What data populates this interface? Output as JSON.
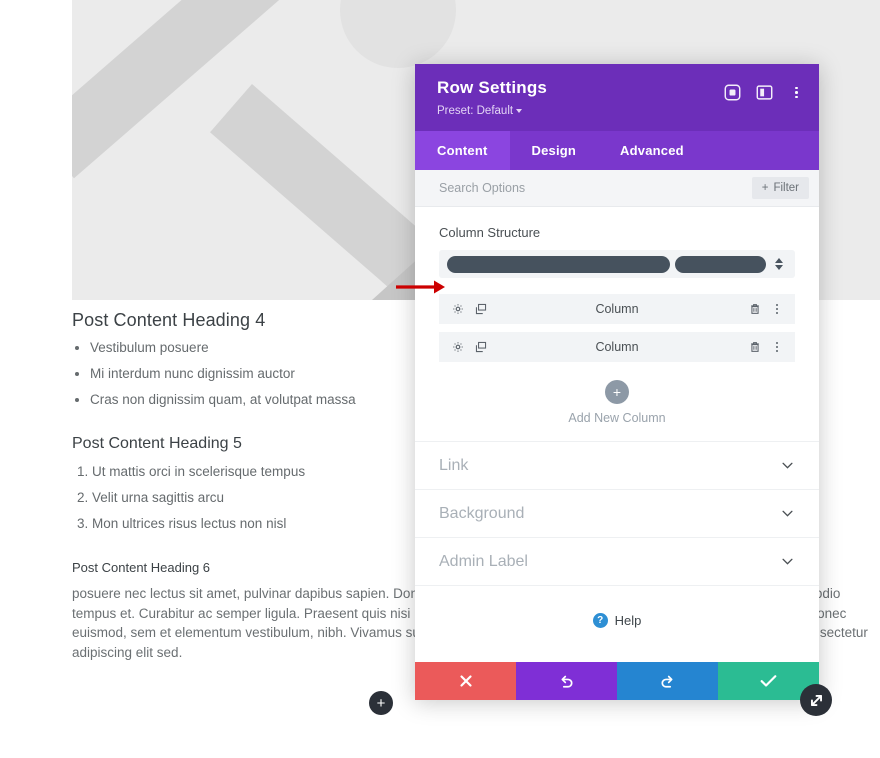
{
  "page": {
    "hero": {
      "alt": "placeholder-image"
    },
    "sections": [
      {
        "heading": "Post Content Heading 4",
        "list_type": "bullet",
        "items": [
          "Vestibulum posuere",
          "Mi interdum nunc dignissim auctor",
          "Cras non dignissim quam, at volutpat massa"
        ]
      },
      {
        "heading": "Post Content Heading 5",
        "list_type": "number",
        "items": [
          "Ut mattis orci in scelerisque tempus",
          "Velit urna sagittis arcu",
          "Mon ultrices risus lectus non nisl"
        ]
      }
    ],
    "heading6": "Post Content Heading 6",
    "paragraph": "posuere nec lectus sit amet, pulvinar dapibus sapien. Donec placerat, urna sed euismod. Proin dictum auctor mi, eu congue odio tempus et. Curabitur ac semper ligula. Praesent quis nisi ligula. Phasellus ne aliquet, condimentum est ut, vehicula sapien. Donec euismod, sem et elementum vestibulum, nibh. Vivamus sus tortor eget felis porttitor volutpat. Lorem ipsum dolor sit amet, consectetur adipiscing elit sed.",
    "add_button_label": "+"
  },
  "modal": {
    "title": "Row Settings",
    "preset_label": "Preset: Default",
    "header_icons": [
      {
        "name": "focus-icon"
      },
      {
        "name": "layout-panel-icon"
      },
      {
        "name": "more-vertical-icon"
      }
    ],
    "tabs": [
      {
        "label": "Content",
        "active": true
      },
      {
        "label": "Design",
        "active": false
      },
      {
        "label": "Advanced",
        "active": false
      }
    ],
    "search": {
      "value": "",
      "placeholder": "Search Options"
    },
    "filter_button": "Filter",
    "column_structure": {
      "label": "Column Structure",
      "columns": [
        {
          "width_ratio": "2/3"
        },
        {
          "width_ratio": "1/3"
        }
      ]
    },
    "columns": [
      {
        "label": "Column"
      },
      {
        "label": "Column"
      }
    ],
    "add_new_column": {
      "icon_label": "+",
      "label": "Add New Column"
    },
    "accordion": [
      {
        "label": "Link"
      },
      {
        "label": "Background"
      },
      {
        "label": "Admin Label"
      }
    ],
    "help": {
      "badge": "?",
      "label": "Help"
    },
    "footer_buttons": [
      {
        "name": "cancel-button",
        "icon": "close-icon",
        "color": "#eb5a5a"
      },
      {
        "name": "undo-button",
        "icon": "undo-icon",
        "color": "#7f2fd6"
      },
      {
        "name": "redo-button",
        "icon": "redo-icon",
        "color": "#2585d1"
      },
      {
        "name": "save-button",
        "icon": "check-icon",
        "color": "#2bbc93"
      }
    ],
    "colors": {
      "header_purple": "#6c2eb9",
      "tabbar_purple": "#7a37cc",
      "tab_active_purple": "#8b45e0",
      "column_chip": "#46525e",
      "row_bg": "#f2f4f6"
    }
  },
  "annotation": {
    "arrow_color": "#cc0000",
    "points_to": "first-column-row"
  }
}
